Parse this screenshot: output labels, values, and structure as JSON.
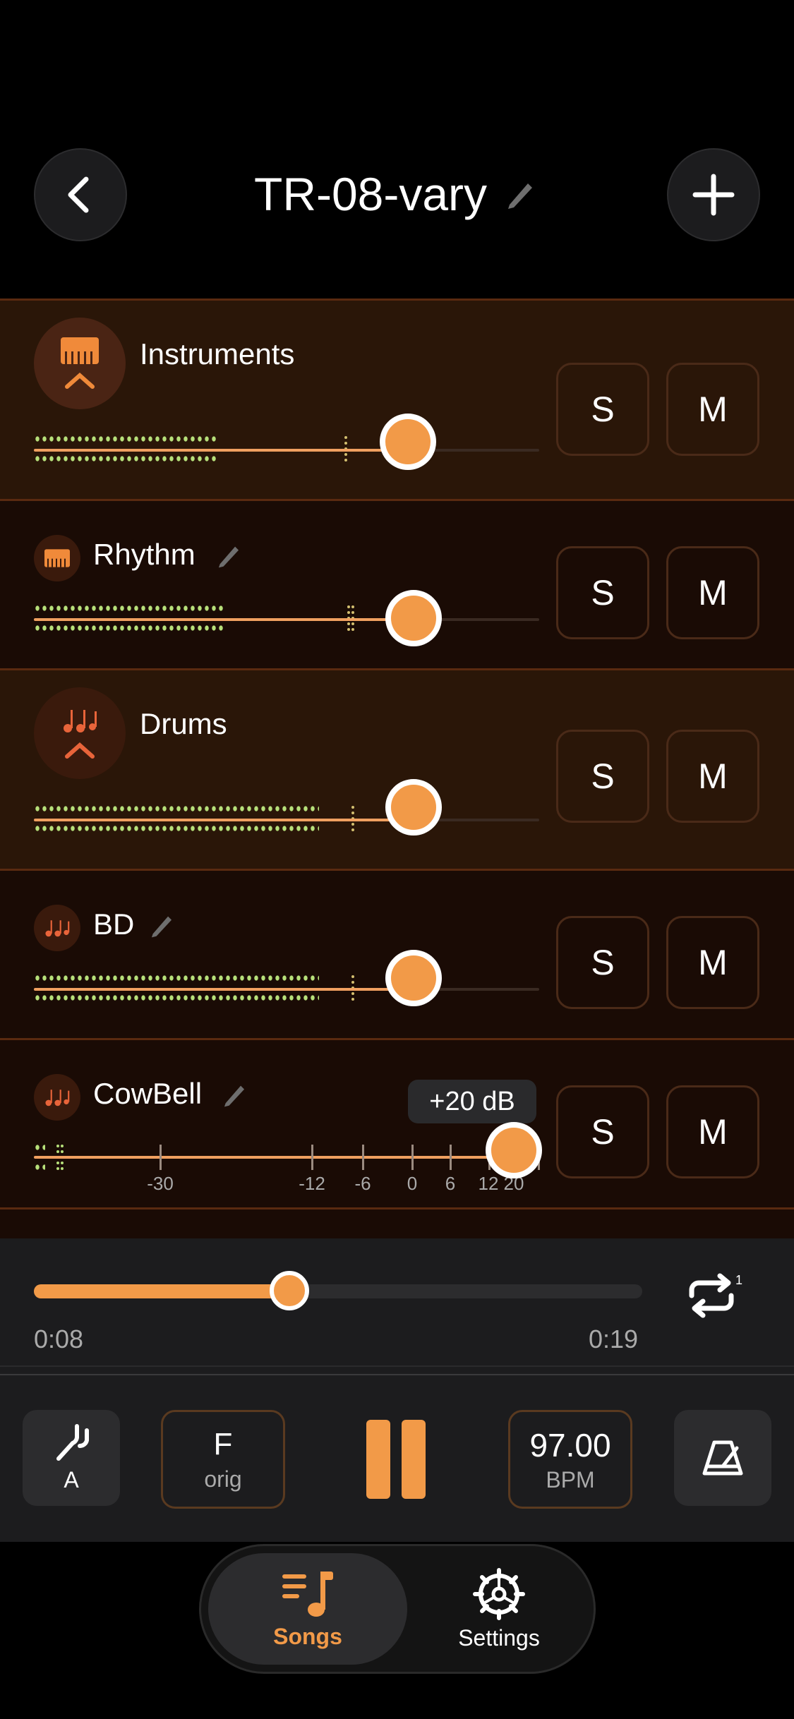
{
  "header": {
    "song_title": "TR-08-vary",
    "back_icon": "chevron-left-icon",
    "add_icon": "plus-icon",
    "edit_icon": "pencil-icon"
  },
  "tracks": [
    {
      "name": "Instruments",
      "type": "group",
      "icon": "piano-icon",
      "expanded": true,
      "solo_label": "S",
      "mute_label": "M",
      "volume_fraction": 0.74,
      "meter_fraction": 0.37
    },
    {
      "name": "Rhythm",
      "type": "child",
      "icon": "piano-icon",
      "editable": true,
      "solo_label": "S",
      "mute_label": "M",
      "volume_fraction": 0.75,
      "meter_fraction": 0.38
    },
    {
      "name": "Drums",
      "type": "group",
      "icon": "music-notes-icon",
      "expanded": true,
      "solo_label": "S",
      "mute_label": "M",
      "volume_fraction": 0.75,
      "meter_fraction": 0.56
    },
    {
      "name": "BD",
      "type": "child",
      "icon": "music-notes-icon",
      "editable": true,
      "solo_label": "S",
      "mute_label": "M",
      "volume_fraction": 0.75,
      "meter_fraction": 0.56
    },
    {
      "name": "CowBell",
      "type": "child",
      "icon": "music-notes-icon",
      "editable": true,
      "solo_label": "S",
      "mute_label": "M",
      "volume_fraction": 1.0,
      "meter_fraction": 0.06,
      "tooltip": "+20 dB",
      "scale_labels": [
        "-30",
        "-12",
        "-6",
        "0",
        "6",
        "12",
        "20"
      ]
    }
  ],
  "playback": {
    "elapsed": "0:08",
    "total": "0:19",
    "progress_fraction": 0.42,
    "repeat_icon": "repeat-one-icon"
  },
  "controls": {
    "tuner": {
      "icon": "tuning-fork-icon",
      "label": "A"
    },
    "key": {
      "value": "F",
      "label": "orig"
    },
    "play_state_icon": "pause-icon",
    "tempo": {
      "value": "97.00",
      "label": "BPM"
    },
    "metronome_icon": "metronome-icon"
  },
  "tabs": [
    {
      "label": "Songs",
      "icon": "music-list-icon",
      "active": true
    },
    {
      "label": "Settings",
      "icon": "gear-icon",
      "active": false
    }
  ],
  "colors": {
    "accent": "#f29a48",
    "meter": "#b7e07a",
    "background": "#000000"
  }
}
